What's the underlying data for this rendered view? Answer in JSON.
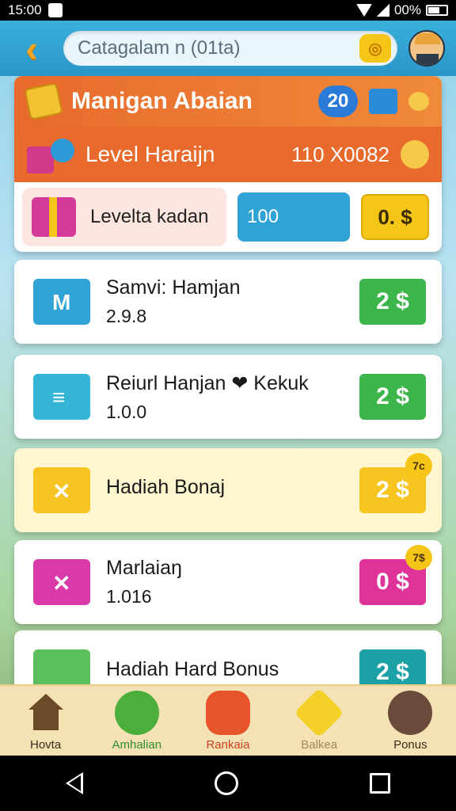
{
  "status_bar": {
    "time": "15:00",
    "battery": "00%"
  },
  "header": {
    "search_text": "Catagalam n (01ta)"
  },
  "promo": {
    "title": "Manigan Abaian",
    "badge": "20",
    "level_title": "Level Haraijn",
    "level_code": "110 X0082",
    "level_item_label": "Levelta kadan",
    "level_value": "100",
    "level_price": "0. $"
  },
  "items": [
    {
      "title": "Samvi: Hamjan",
      "subtitle": "2.9.8",
      "price": "2 $",
      "tag": ""
    },
    {
      "title": "Reiurl Hanjan ❤ Kekuk",
      "subtitle": "1.0.0",
      "price": "2 $",
      "tag": ""
    },
    {
      "title": "Hadiah Bonaj",
      "subtitle": "",
      "price": "2 $",
      "tag": "7c"
    },
    {
      "title": "Marlaiaŋ",
      "subtitle": "1.016",
      "price": "0 $",
      "tag": "7$"
    },
    {
      "title": "Hadiah Hard Bonus",
      "subtitle": "",
      "price": "2 $",
      "tag": ""
    }
  ],
  "bottom_nav": [
    {
      "label": "Hovta"
    },
    {
      "label": "Amhalian"
    },
    {
      "label": "Rankaia"
    },
    {
      "label": "Balkea"
    },
    {
      "label": "Ponus"
    }
  ]
}
